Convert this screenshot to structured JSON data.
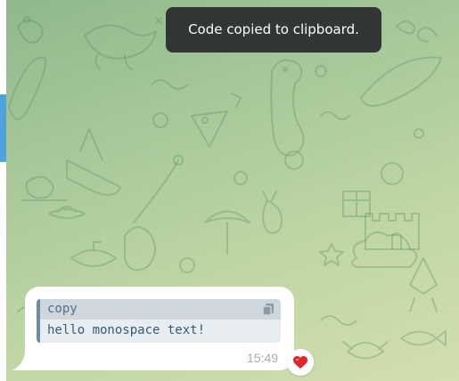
{
  "toast": {
    "text": "Code copied to clipboard."
  },
  "message": {
    "code_block": {
      "language": "copy",
      "code": "hello monospace text!",
      "copy_icon": "copy-icon"
    },
    "time": "15:49",
    "reaction": {
      "emoji": "❤️",
      "icon": "heart-icon"
    }
  },
  "colors": {
    "accent": "#4fa3dc",
    "code_border": "#6f8ba2",
    "code_header_bg": "#cfd7de",
    "code_body_bg": "#e8edf1",
    "code_text": "#37597a",
    "toast_bg": "#2a2c2e",
    "reaction_heart": "#e0282a",
    "chat_background_start": "#8fb88d",
    "chat_background_end": "#d3deb0"
  }
}
